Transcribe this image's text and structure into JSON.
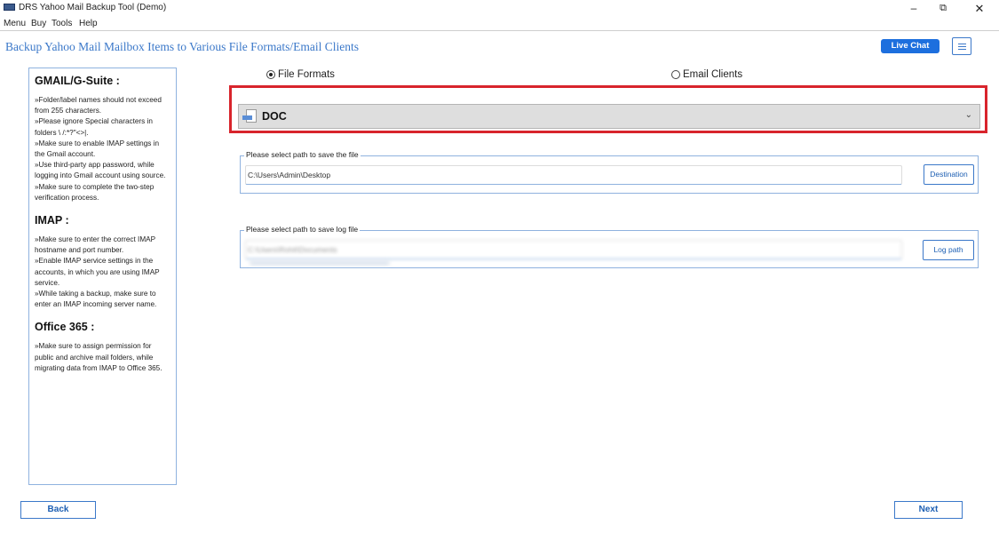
{
  "window": {
    "title": "DRS Yahoo Mail Backup Tool (Demo)",
    "minimize": "–",
    "maximize": "⧉",
    "close": "✕"
  },
  "menubar": {
    "items": [
      "Menu",
      "Buy",
      "Tools",
      "Help"
    ]
  },
  "header": {
    "title": "Backup Yahoo Mail Mailbox Items to Various File Formats/Email Clients",
    "live_chat_label": "Live Chat",
    "hamburger_icon": "menu-icon"
  },
  "info_panel": {
    "sections": [
      {
        "heading": "GMAIL/G-Suite :",
        "lines": [
          "»Folder/label names should not exceed from 255 characters.",
          "»Please ignore Special characters in folders \\ /:*?\"<>|.",
          "»Make sure to enable IMAP settings in the Gmail account.",
          "»Use third-party app password, while logging into Gmail account using source.",
          "»Make sure to complete the two-step verification process."
        ]
      },
      {
        "heading": "IMAP :",
        "lines": [
          "»Make sure to enter the correct IMAP hostname and port number.",
          "»Enable IMAP service settings in the accounts, in which you are using IMAP service.",
          "»While taking a backup, make sure to enter an IMAP incoming server name."
        ]
      },
      {
        "heading": "Office 365 :",
        "lines": [
          "»Make sure to assign permission for public and archive mail folders, while migrating data from IMAP to Office 365."
        ]
      }
    ]
  },
  "options": {
    "file_formats_label": "File Formats",
    "file_formats_checked": true,
    "email_clients_label": "Email Clients",
    "email_clients_checked": false
  },
  "format_select": {
    "selected": "DOC",
    "icon": "doc-file-icon",
    "highlight_color": "#d8242c"
  },
  "save_path": {
    "legend": "Please select path to save the file",
    "value": "C:\\Users\\Admin\\Desktop",
    "button_label": "Destination"
  },
  "log_path": {
    "legend": "Please select path to save log file",
    "value": "C:\\Users\\Rohit\\Documents",
    "button_label": "Log path"
  },
  "footer": {
    "back_label": "Back",
    "next_label": "Next"
  },
  "colors": {
    "accent": "#3b78c9",
    "button_blue": "#1d6fde",
    "panel_border": "#8fb2df"
  }
}
